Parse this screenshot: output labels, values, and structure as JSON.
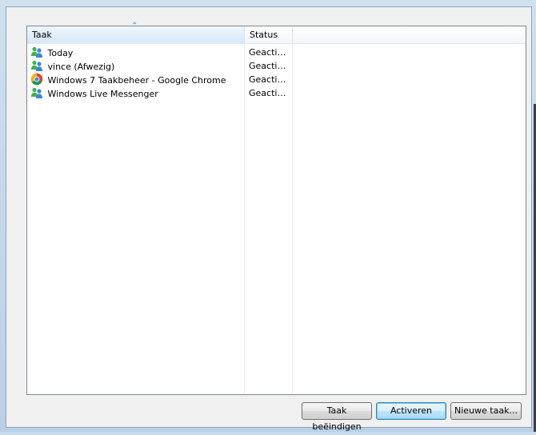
{
  "listview": {
    "columns": [
      {
        "label": "Taak",
        "sorted": true
      },
      {
        "label": "Status",
        "sorted": false
      }
    ],
    "rows": [
      {
        "name": "Today",
        "status": "Geacti…",
        "icon": "messenger-icon"
      },
      {
        "name": "vince (Afwezig)",
        "status": "Geacti…",
        "icon": "messenger-icon"
      },
      {
        "name": "Windows 7 Taakbeheer - Google Chrome",
        "status": "Geacti…",
        "icon": "chrome-icon"
      },
      {
        "name": "Windows Live Messenger",
        "status": "Geacti…",
        "icon": "messenger-icon"
      }
    ]
  },
  "buttons": {
    "end_task": "Taak beëindigen",
    "switch_to": "Activeren",
    "new_task": "Nieuwe taak..."
  },
  "colors": {
    "default_button_border": "#3c7fb1",
    "listview_border": "#828790",
    "dialog_background": "#f0f0f0"
  }
}
